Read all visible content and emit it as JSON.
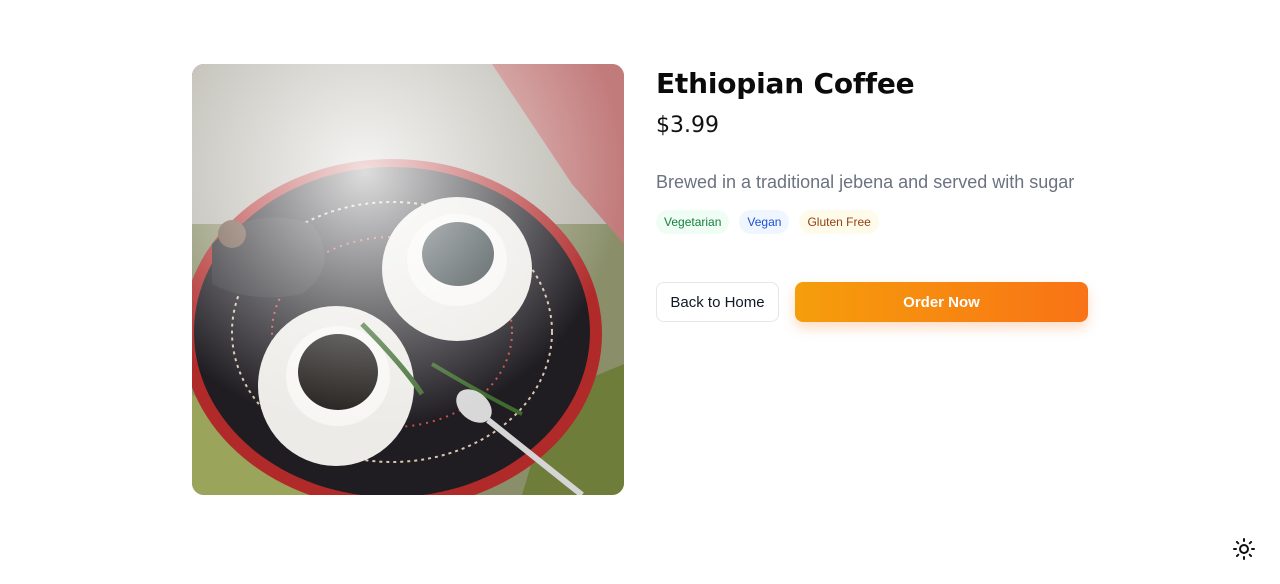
{
  "product": {
    "title": "Ethiopian Coffee",
    "price": "$3.99",
    "description": "Brewed in a traditional jebena and served with sugar",
    "tags": [
      {
        "label": "Vegetarian",
        "color": "#15803d"
      },
      {
        "label": "Vegan",
        "color": "#1d4ed8"
      },
      {
        "label": "Gluten Free",
        "color": "#92400e"
      }
    ],
    "image_icon": "coffee-ceremony-photo"
  },
  "actions": {
    "back_label": "Back to Home",
    "order_label": "Order Now"
  },
  "theme": {
    "accent_start": "#f59e0b",
    "accent_end": "#f97316",
    "toggle_icon": "sun-icon"
  }
}
